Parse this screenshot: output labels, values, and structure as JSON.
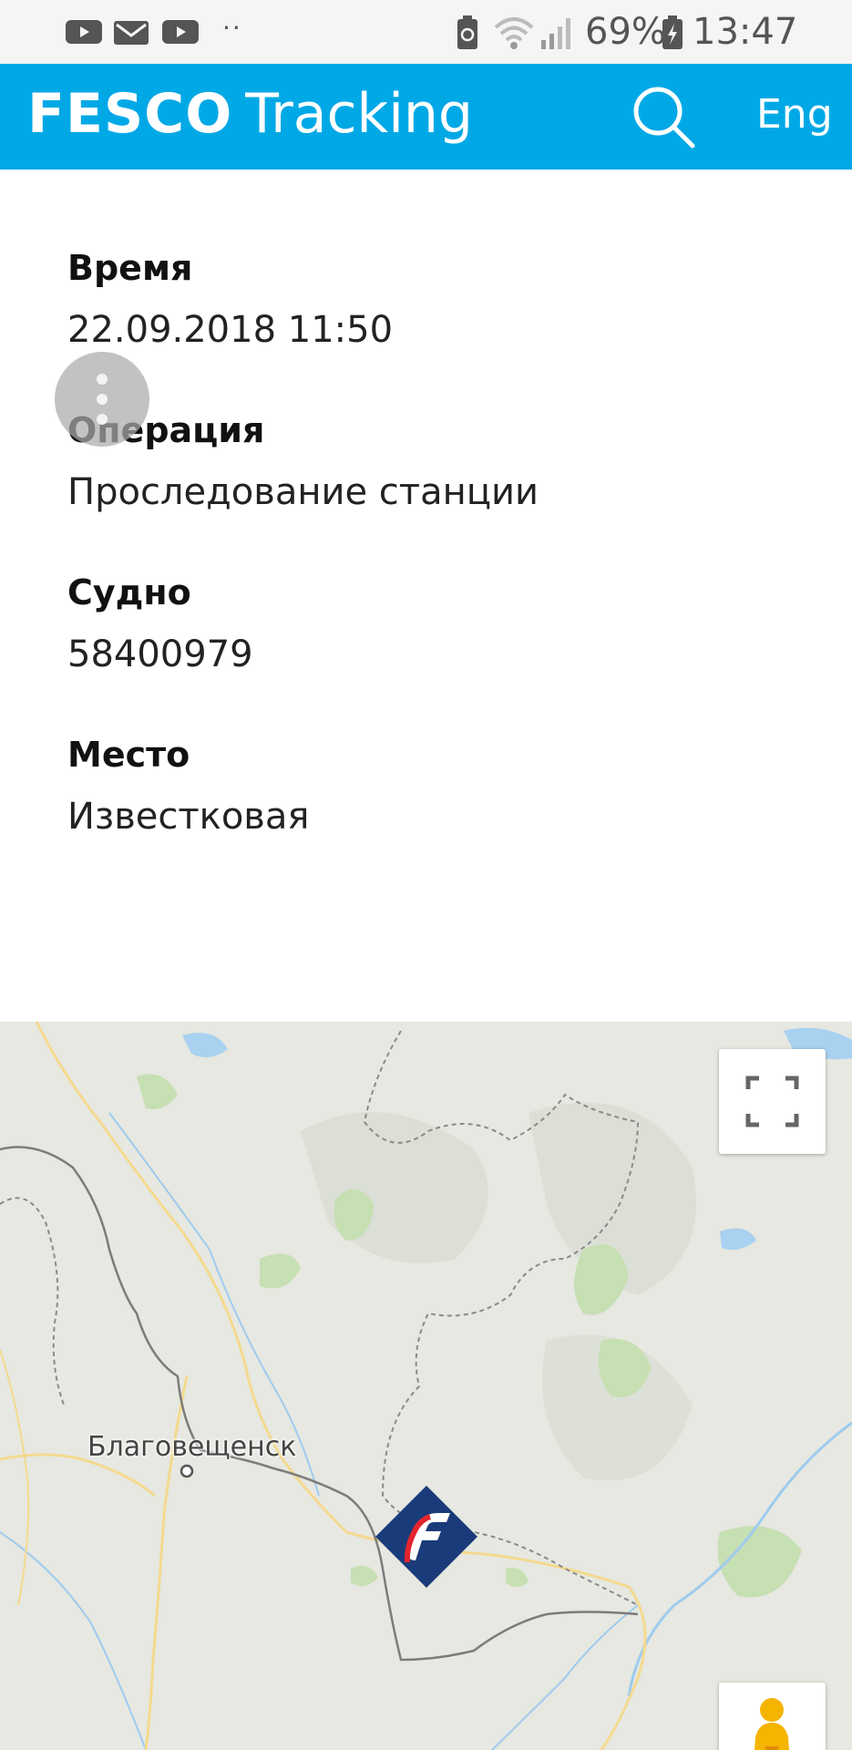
{
  "status_bar": {
    "battery_percent": "69%",
    "time": "13:47",
    "notification_dots": "··",
    "icons": [
      "youtube-icon",
      "mail-icon",
      "youtube-icon",
      "battery-saver-icon",
      "wifi-icon",
      "signal-icon",
      "battery-icon"
    ]
  },
  "header": {
    "brand_bold": "FESCO",
    "brand_light": "Tracking",
    "language": "Eng",
    "background": "#00a8e6"
  },
  "details": {
    "time_label": "Время",
    "time_value": "22.09.2018 11:50",
    "operation_label": "Операция",
    "operation_value": "Проследование станции",
    "vessel_label": "Судно",
    "vessel_value": "58400979",
    "place_label": "Место",
    "place_value": "Известковая"
  },
  "map": {
    "city": "Благовещенск",
    "marker_brand_color": "#1a3b7a",
    "marker_accent_color": "#e3262e"
  }
}
